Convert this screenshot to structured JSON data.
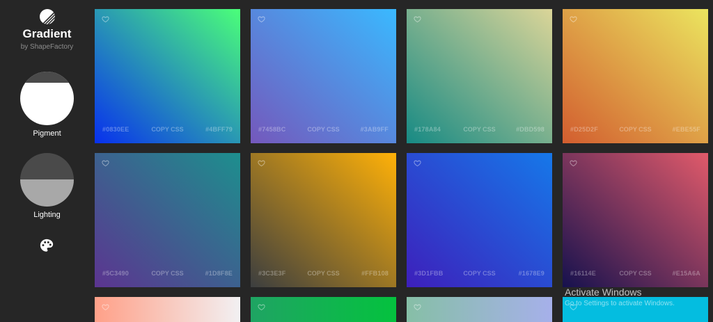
{
  "sidebar": {
    "logo_icon": "gradient-logo-icon",
    "title": "Gradient",
    "subtitle": "by ShapeFactory",
    "pigment_label": "Pigment",
    "lighting_label": "Lighting",
    "palette_icon": "palette-icon"
  },
  "card_actions": {
    "copy_label": "COPY CSS",
    "heart_icon": "heart-icon"
  },
  "cards": [
    {
      "start": "#0830EE",
      "end": "#4BFF79",
      "direction": "to top right"
    },
    {
      "start": "#7458BC",
      "end": "#3AB9FF",
      "direction": "to top right"
    },
    {
      "start": "#178A84",
      "end": "#DBD598",
      "direction": "to top right"
    },
    {
      "start": "#D25D2F",
      "end": "#EBE55F",
      "direction": "to top right"
    },
    {
      "start": "#5C3490",
      "end": "#1D8F8E",
      "direction": "to top right"
    },
    {
      "start": "#3C3E3F",
      "end": "#FFB108",
      "direction": "to top right"
    },
    {
      "start": "#3D1FBB",
      "end": "#1678E9",
      "direction": "to top right"
    },
    {
      "start": "#16114E",
      "end": "#E15A6A",
      "direction": "to top right"
    },
    {
      "start": "#FFA088",
      "end": "#F2F0F2",
      "direction": "to right"
    },
    {
      "start": "#1FA463",
      "end": "#04C23E",
      "direction": "to right"
    },
    {
      "start": "#86BFA6",
      "end": "#A6B0EA",
      "direction": "to right"
    },
    {
      "start": "#04BDE0",
      "end": "#04BDE0",
      "direction": "to right"
    }
  ],
  "watermark": {
    "title": "Activate Windows",
    "subtitle": "Go to Settings to activate Windows."
  }
}
